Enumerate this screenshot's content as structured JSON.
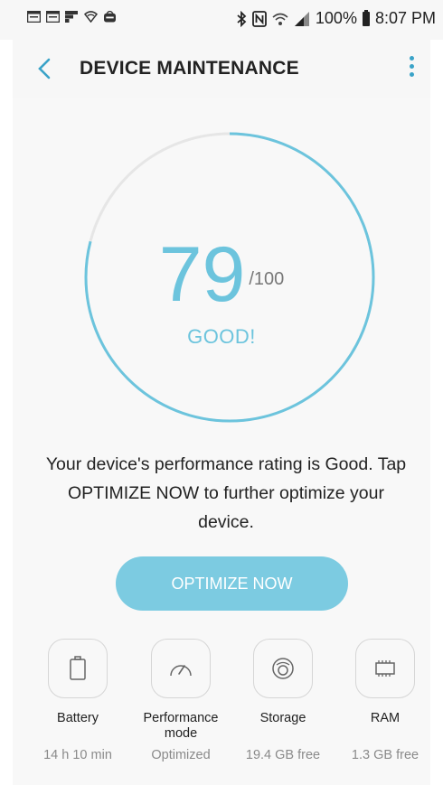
{
  "status_bar": {
    "battery": "100%",
    "time": "8:07 PM",
    "left_icons": [
      "calendar-icon",
      "calendar-icon",
      "flipboard-icon",
      "wifi-shield-icon",
      "menu-bag-icon"
    ],
    "right_icons": [
      "bluetooth-icon",
      "nfc-icon",
      "wifi-icon",
      "signal-icon",
      "battery-icon"
    ]
  },
  "app_bar": {
    "title": "DEVICE MAINTENANCE"
  },
  "gauge": {
    "score": "79",
    "max": "/100",
    "rating": "GOOD!",
    "fraction": 0.79,
    "accent_color": "#6cc4dd",
    "track_color": "#e6e6e6"
  },
  "description": "Your device's performance rating is Good. Tap OPTIMIZE NOW to further optimize your device.",
  "optimize_button": "OPTIMIZE NOW",
  "items": [
    {
      "icon": "battery-icon",
      "label": "Battery",
      "value": "14 h 10 min"
    },
    {
      "icon": "performance-gauge-icon",
      "label": "Performance mode",
      "value": "Optimized"
    },
    {
      "icon": "storage-disk-icon",
      "label": "Storage",
      "value": "19.4 GB free"
    },
    {
      "icon": "ram-chip-icon",
      "label": "RAM",
      "value": "1.3 GB free"
    }
  ]
}
